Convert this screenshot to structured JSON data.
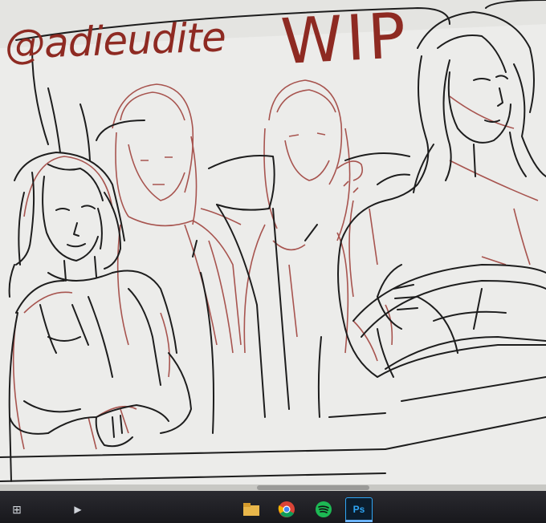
{
  "canvas": {
    "handle_text": "@adieudite",
    "wip_text": "WIP",
    "line_color": "#1d1d1d",
    "sketch_color": "#9c3a34",
    "paper_color": "#ededeb"
  },
  "taskbar": {
    "icons": [
      "windows-start-icon",
      "media-icon",
      "file-explorer-icon",
      "chrome-icon",
      "spotify-icon",
      "photoshop-icon"
    ],
    "ps_label": "Ps"
  }
}
